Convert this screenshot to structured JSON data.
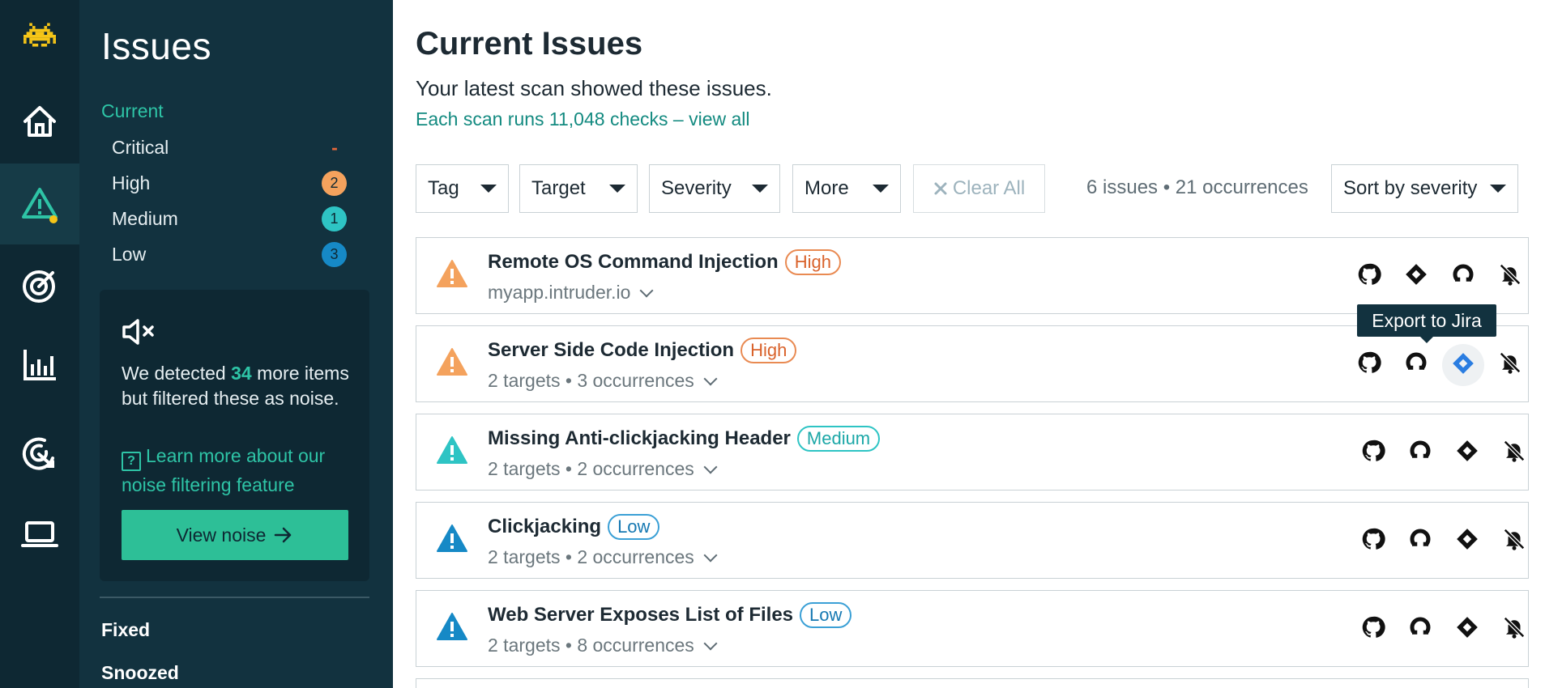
{
  "sidebar": {
    "title": "Issues",
    "current_label": "Current",
    "severities": [
      {
        "label": "Critical",
        "count": "-"
      },
      {
        "label": "High",
        "count": "2"
      },
      {
        "label": "Medium",
        "count": "1"
      },
      {
        "label": "Low",
        "count": "3"
      }
    ],
    "noise": {
      "text_before": "We detected ",
      "count": "34",
      "text_after": " more items but filtered these as noise.",
      "help_glyph": "?",
      "link": "Learn more about our noise filtering feature",
      "button": "View noise"
    },
    "fixed": "Fixed",
    "snoozed": "Snoozed"
  },
  "main": {
    "title": "Current Issues",
    "subtitle": "Your latest scan showed these issues.",
    "scan_link": "Each scan runs 11,048 checks – view all",
    "filters": {
      "tag": "Tag",
      "target": "Target",
      "severity": "Severity",
      "more": "More",
      "clear": "Clear All"
    },
    "summary": "6 issues • 21 occurrences",
    "sort": "Sort by severity",
    "tooltip": "Export to Jira",
    "issues": [
      {
        "name": "Remote OS Command Injection",
        "severity": "High",
        "meta": "myapp.intruder.io"
      },
      {
        "name": "Server Side Code Injection",
        "severity": "High",
        "meta": "2 targets • 3 occurrences"
      },
      {
        "name": "Missing Anti-clickjacking Header",
        "severity": "Medium",
        "meta": "2 targets • 2 occurrences"
      },
      {
        "name": "Clickjacking",
        "severity": "Low",
        "meta": "2 targets • 2 occurrences"
      },
      {
        "name": "Web Server Exposes List of Files",
        "severity": "Low",
        "meta": "2 targets • 8 occurrences"
      }
    ]
  },
  "colors": {
    "rail": "#0e2833",
    "sidebar": "#12323f",
    "accent": "#2ec4a6",
    "high": "#f4a25d",
    "medium": "#2ec4c4",
    "low": "#1689c6"
  },
  "icons": {
    "rail": [
      "logo-invader-icon",
      "home-icon",
      "warning-icon",
      "target-icon",
      "bar-chart-icon",
      "radar-icon",
      "laptop-icon"
    ],
    "actions": [
      "github-icon",
      "jira-icon",
      "gitlab-icon",
      "snooze-bell-icon"
    ]
  }
}
